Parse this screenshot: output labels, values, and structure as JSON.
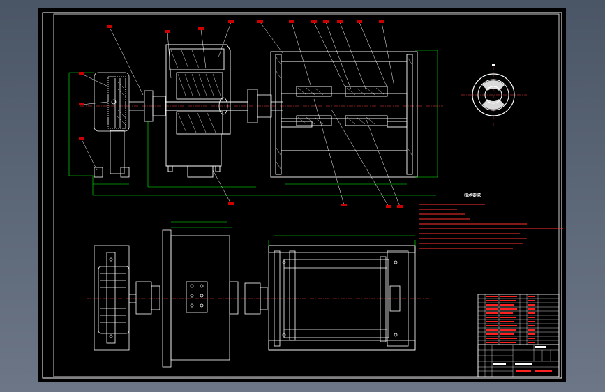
{
  "window": {
    "background": "#5a6576",
    "sheet_color": "#000000"
  },
  "colors": {
    "outline": "#ffffff",
    "dimension": "#00ff00",
    "leader": "#ffffff",
    "callout": "#ff0000",
    "centerline": "#ff4040",
    "note_text": "#ff2020"
  },
  "notes": {
    "title": "技术要求"
  },
  "views": [
    "front-section-view",
    "top-plan-view",
    "end-view"
  ],
  "icons": [
    "sheet-border",
    "title-block",
    "parts-list"
  ]
}
